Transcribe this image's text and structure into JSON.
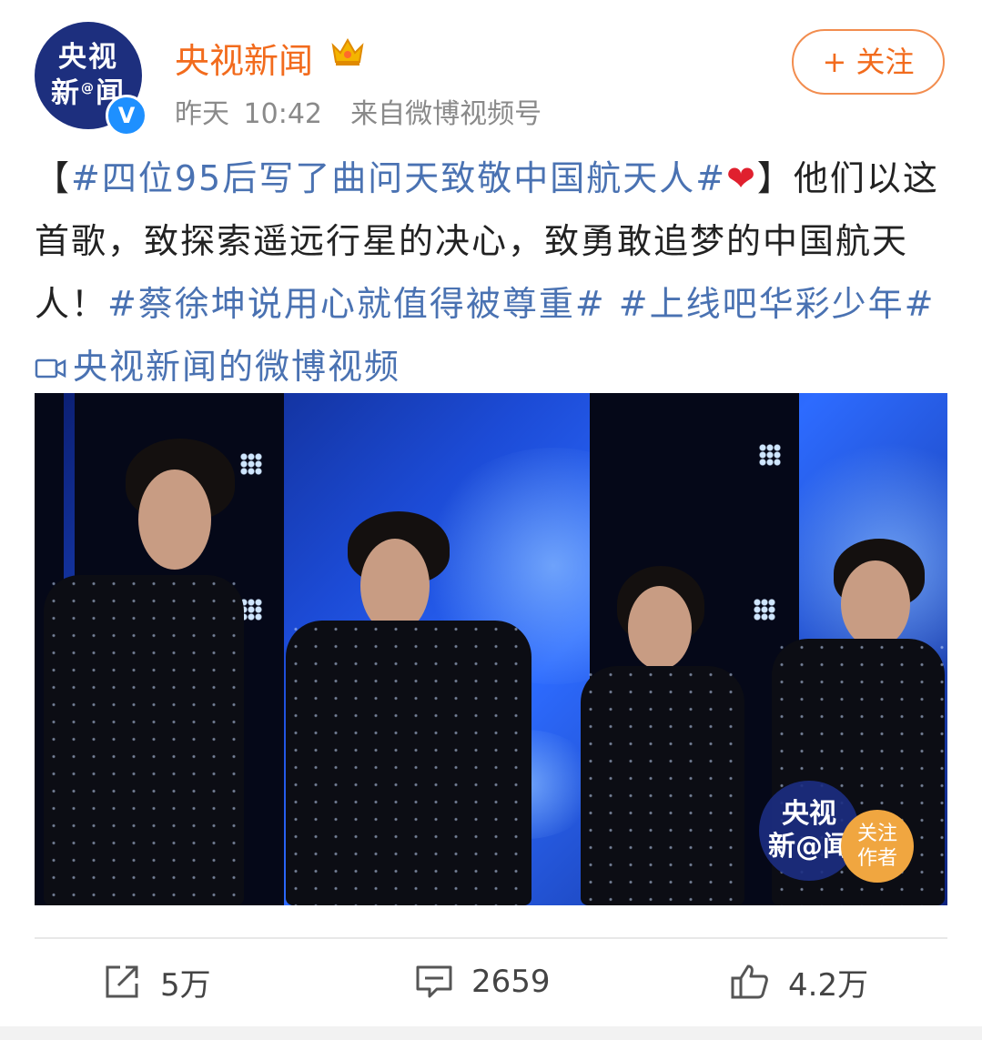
{
  "post": {
    "author": {
      "name": "央视新闻",
      "avatar_line1": "央视",
      "avatar_line2": "新",
      "avatar_at": "@",
      "avatar_line2b": "闻",
      "verified_mark": "V"
    },
    "timestamp": "昨天 10:42",
    "source": "来自微博视频号",
    "follow_label": "+ 关注",
    "text": {
      "bracket_open": "【",
      "hashtag1": "#四位95后写了曲问天致敬中国航天人#",
      "heart": "❤",
      "bracket_close": "】",
      "body": "他们以这首歌，致探索遥远行星的决心，致勇敢追梦的中国航天人！",
      "hashtag2": "#蔡徐坤说用心就值得被尊重#",
      "hashtag3": "#上线吧华彩少年#",
      "video_link": "央视新闻的微博视频"
    },
    "video": {
      "watermark_line1": "央视",
      "watermark_line2": "新@闻",
      "follow_badge_line1": "关注",
      "follow_badge_line2": "作者"
    }
  },
  "actions": {
    "repost_count": "5万",
    "comment_count": "2659",
    "like_count": "4.2万"
  },
  "colors": {
    "brand_orange": "#f26b1d",
    "link_blue": "#4a72b2",
    "verified_blue": "#1e90ff"
  },
  "icons": {
    "crown": "crown-icon",
    "repost": "share-icon",
    "comment": "comment-icon",
    "like": "thumbs-up-icon",
    "video": "video-camera-icon"
  }
}
